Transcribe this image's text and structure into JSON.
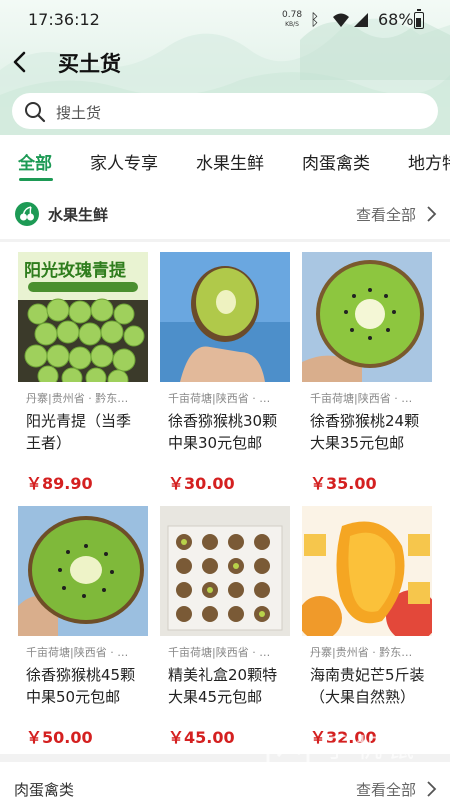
{
  "status": {
    "time": "17:36:12",
    "net_speed": "0.78",
    "net_unit": "KB/S",
    "battery": "68%"
  },
  "header": {
    "title": "买土货"
  },
  "search": {
    "placeholder": "搜土货"
  },
  "tabs": [
    {
      "label": "全部",
      "active": true
    },
    {
      "label": "家人专享"
    },
    {
      "label": "水果生鲜"
    },
    {
      "label": "肉蛋禽类"
    },
    {
      "label": "地方特"
    }
  ],
  "section": {
    "title": "水果生鲜",
    "more": "查看全部"
  },
  "products": [
    {
      "origin": "丹寨|贵州省 · 黔东…",
      "name": "阳光青提（当季王者）",
      "price": "￥89.90",
      "banner": "阳光玫瑰青提"
    },
    {
      "origin": "千亩荷塘|陕西省 · …",
      "name": "徐香猕猴桃30颗中果30元包邮",
      "price": "￥30.00"
    },
    {
      "origin": "千亩荷塘|陕西省 · …",
      "name": "徐香猕猴桃24颗大果35元包邮",
      "price": "￥35.00"
    },
    {
      "origin": "千亩荷塘|陕西省 · …",
      "name": "徐香猕猴桃45颗中果50元包邮",
      "price": "￥50.00"
    },
    {
      "origin": "千亩荷塘|陕西省 · …",
      "name": "精美礼盒20颗特大果45元包邮",
      "price": "￥45.00"
    },
    {
      "origin": "丹寨|贵州省 · 黔东…",
      "name": "海南贵妃芒5斤装（大果自然熟）",
      "price": "￥32.00"
    }
  ],
  "section2": {
    "title": "肉蛋禽类",
    "more": "查看全部"
  },
  "watermark": {
    "text": "手机鼠",
    "sub": "SHOUJISHU"
  },
  "colors": {
    "accent": "#1d9a55",
    "price": "#d42020"
  }
}
